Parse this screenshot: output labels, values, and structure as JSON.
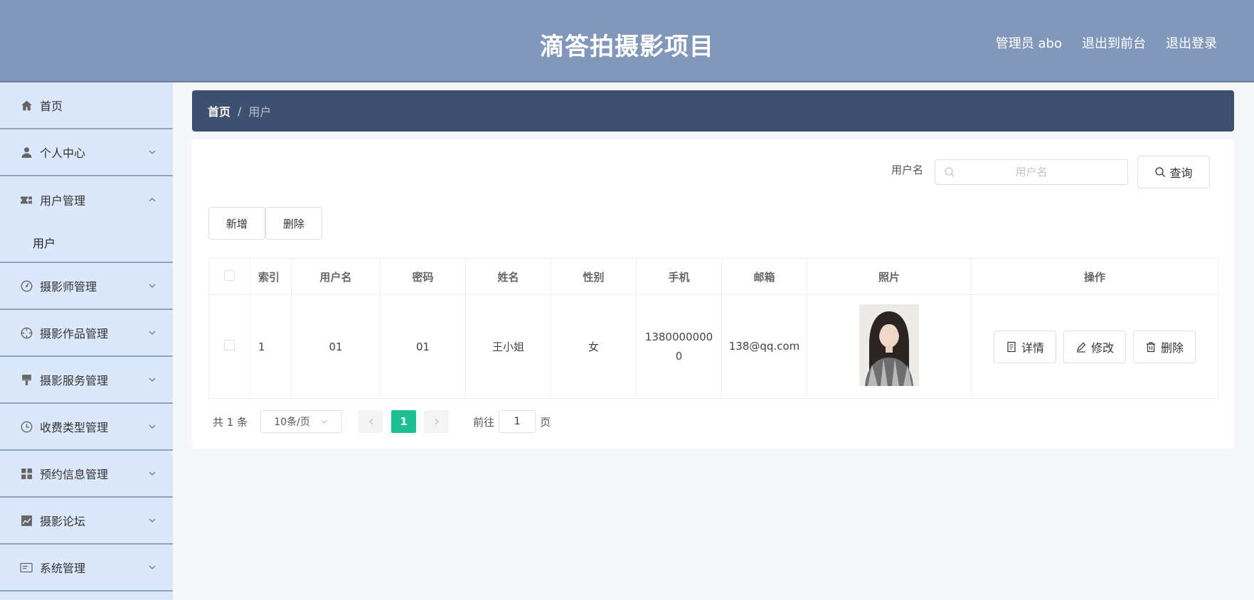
{
  "header": {
    "title": "滴答拍摄影项目",
    "user": "管理员 abo",
    "back_to_front": "退出到前台",
    "logout": "退出登录"
  },
  "sidebar": {
    "items": [
      {
        "label": "首页",
        "icon": "home-icon"
      },
      {
        "label": "个人中心",
        "icon": "user-icon"
      },
      {
        "label": "用户管理",
        "icon": "ticket-icon",
        "open": true,
        "children": [
          {
            "label": "用户"
          }
        ]
      },
      {
        "label": "摄影师管理",
        "icon": "dashboard-icon"
      },
      {
        "label": "摄影作品管理",
        "icon": "aim-icon"
      },
      {
        "label": "摄影服务管理",
        "icon": "brush-icon"
      },
      {
        "label": "收费类型管理",
        "icon": "clock-icon"
      },
      {
        "label": "预约信息管理",
        "icon": "grid-icon"
      },
      {
        "label": "摄影论坛",
        "icon": "chart-icon"
      },
      {
        "label": "系统管理",
        "icon": "message-icon"
      }
    ]
  },
  "breadcrumb": {
    "home": "首页",
    "separator": "/",
    "current": "用户"
  },
  "search": {
    "label": "用户名",
    "placeholder": "用户名",
    "value": "",
    "button": "查询"
  },
  "actions": {
    "add": "新增",
    "delete": "删除"
  },
  "table": {
    "headers": [
      "索引",
      "用户名",
      "密码",
      "姓名",
      "性别",
      "手机",
      "邮箱",
      "照片",
      "操作"
    ],
    "rows": [
      {
        "index": "1",
        "username": "01",
        "password": "01",
        "name": "王小姐",
        "gender": "女",
        "phone": "13800000000",
        "email": "138@qq.com",
        "ops": {
          "detail": "详情",
          "edit": "修改",
          "delete": "删除"
        }
      }
    ]
  },
  "pagination": {
    "total": "共 1 条",
    "page_size": "10条/页",
    "current_page": "1",
    "goto_label": "前往",
    "goto_value": "1",
    "page_unit": "页"
  },
  "colors": {
    "header_bg": "#8198ba",
    "sidebar_bg": "#dbe7fb",
    "breadcrumb_bg": "#3e506f",
    "accent": "#1fbf94"
  }
}
